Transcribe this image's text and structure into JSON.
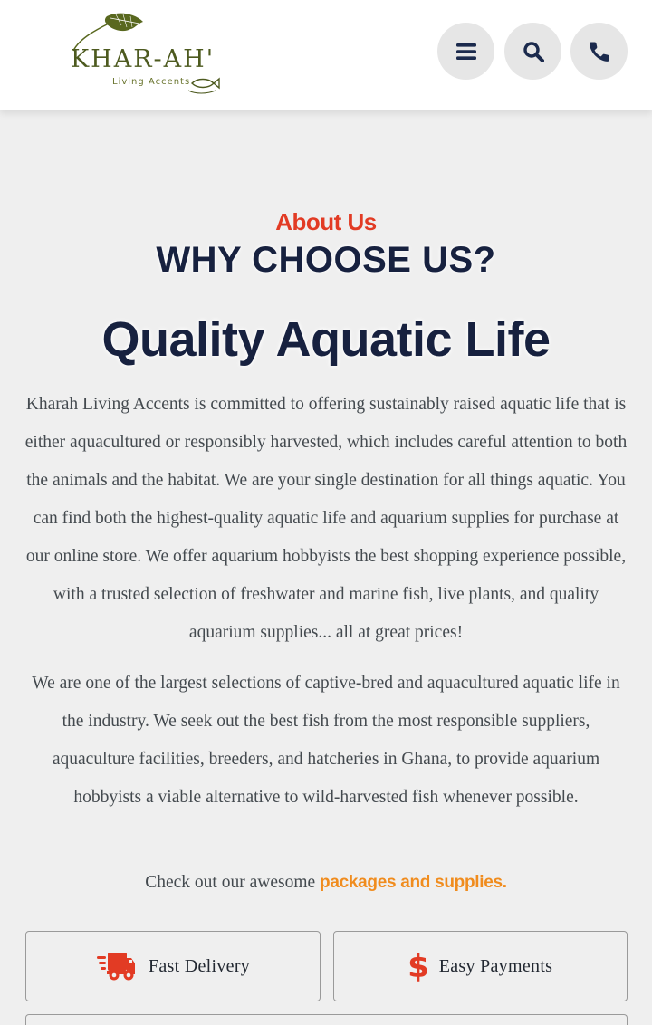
{
  "header": {
    "logo": {
      "name": "KHAR-AH'",
      "tagline": "Living Accents",
      "icons": [
        "leaf-icon",
        "fish-icon"
      ]
    },
    "buttons": [
      {
        "icon": "menu-icon"
      },
      {
        "icon": "search-icon"
      },
      {
        "icon": "phone-icon"
      }
    ]
  },
  "about": {
    "eyebrow": "About Us",
    "heading": "WHY CHOOSE US?",
    "subheading": "Quality Aquatic Life",
    "paragraphs": [
      "Kharah Living Accents is committed to offering sustainably raised aquatic life that is either aquacultured or responsibly harvested, which includes careful attention to both the animals and the habitat. We are your single destination for all things aquatic. You can find both the highest-quality aquatic life and aquarium supplies for purchase at our online store. We offer aquarium hobbyists the best shopping experience possible, with a trusted selection of freshwater and marine fish, live plants, and quality aquarium supplies... all at great prices!",
      "We are one of the largest selections of captive-bred and aquacultured aquatic life in the industry. We seek out the best fish from the most responsible suppliers, aquaculture facilities, breeders, and hatcheries in Ghana, to provide aquarium hobbyists a viable alternative to wild-harvested fish whenever possible."
    ],
    "cta": {
      "text": "Check out our awesome ",
      "link_text": "packages and supplies."
    }
  },
  "features": [
    {
      "icon": "delivery-truck-icon",
      "label": "Fast Delivery"
    },
    {
      "icon": "dollar-icon",
      "label": "Easy Payments"
    }
  ],
  "colors": {
    "accent_red": "#e23b24",
    "link_orange": "#f08c1e",
    "navy": "#17213f",
    "logo_green": "#4d5a1f",
    "body_text": "#444a4f",
    "background": "#efefef"
  }
}
